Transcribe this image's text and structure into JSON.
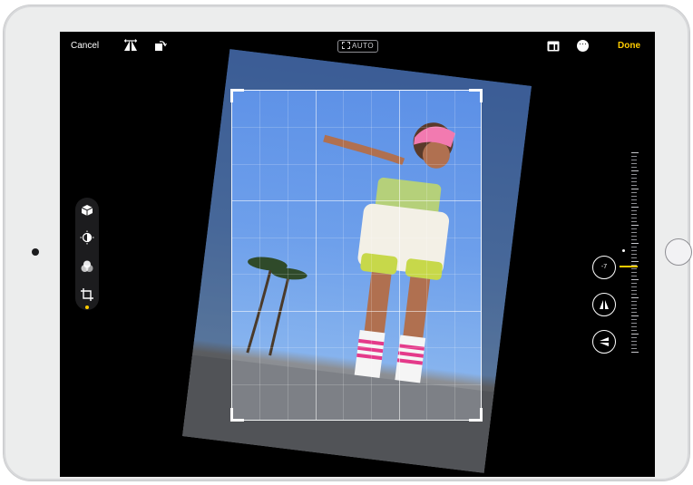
{
  "toolbar": {
    "cancel_label": "Cancel",
    "done_label": "Done",
    "auto_label": "AUTO",
    "accent_color": "#ffcc00"
  },
  "icons": {
    "flip": "flip-horizontal-icon",
    "rotate": "rotate-icon",
    "aspect": "aspect-ratio-icon",
    "more": "more-icon",
    "tools": [
      "adjust-icon",
      "filters-icon",
      "crop-icon"
    ],
    "right": [
      "straighten-icon",
      "vertical-perspective-icon",
      "horizontal-perspective-icon"
    ]
  },
  "adjustments": {
    "straighten_value": "-7"
  }
}
